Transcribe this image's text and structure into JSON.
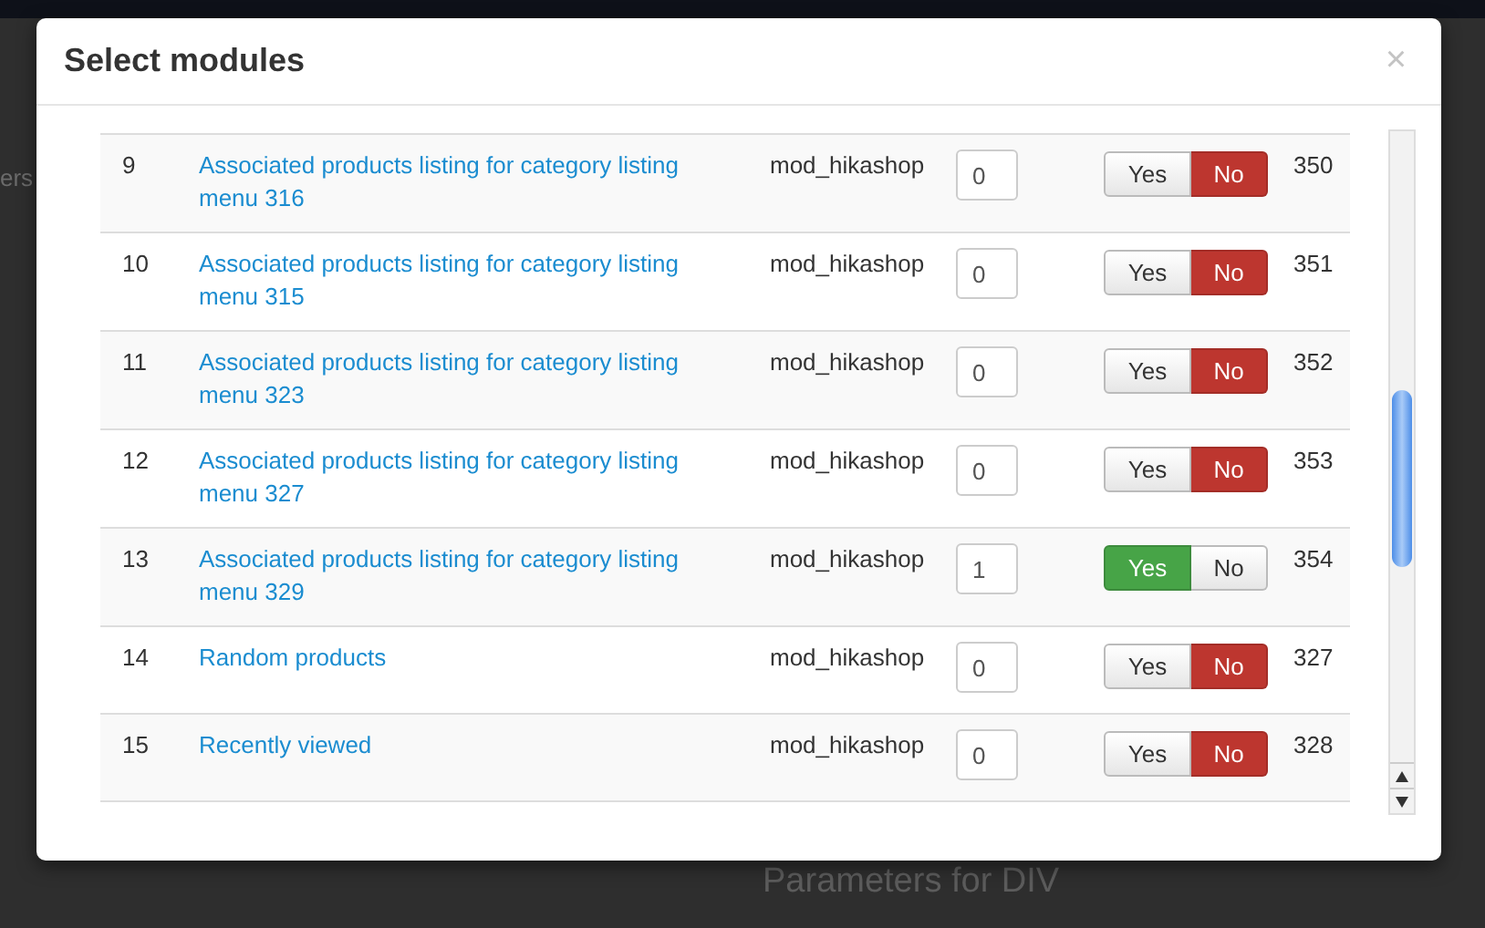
{
  "background": {
    "menu_fragment": "ers",
    "heading": "Parameters for DIV"
  },
  "modal": {
    "title": "Select modules",
    "close": "×"
  },
  "rows": [
    {
      "number": "9",
      "name": "Associated products listing for category listing menu 316",
      "type": "mod_hikashop",
      "order": "0",
      "yes_label": "Yes",
      "no_label": "No",
      "published": false,
      "id": "350"
    },
    {
      "number": "10",
      "name": "Associated products listing for category listing menu 315",
      "type": "mod_hikashop",
      "order": "0",
      "yes_label": "Yes",
      "no_label": "No",
      "published": false,
      "id": "351"
    },
    {
      "number": "11",
      "name": "Associated products listing for category listing menu 323",
      "type": "mod_hikashop",
      "order": "0",
      "yes_label": "Yes",
      "no_label": "No",
      "published": false,
      "id": "352"
    },
    {
      "number": "12",
      "name": "Associated products listing for category listing menu 327",
      "type": "mod_hikashop",
      "order": "0",
      "yes_label": "Yes",
      "no_label": "No",
      "published": false,
      "id": "353"
    },
    {
      "number": "13",
      "name": "Associated products listing for category listing menu 329",
      "type": "mod_hikashop",
      "order": "1",
      "yes_label": "Yes",
      "no_label": "No",
      "published": true,
      "id": "354"
    },
    {
      "number": "14",
      "name": "Random products",
      "type": "mod_hikashop",
      "order": "0",
      "yes_label": "Yes",
      "no_label": "No",
      "published": false,
      "id": "327"
    },
    {
      "number": "15",
      "name": "Recently viewed",
      "type": "mod_hikashop",
      "order": "0",
      "yes_label": "Yes",
      "no_label": "No",
      "published": false,
      "id": "328"
    }
  ]
}
